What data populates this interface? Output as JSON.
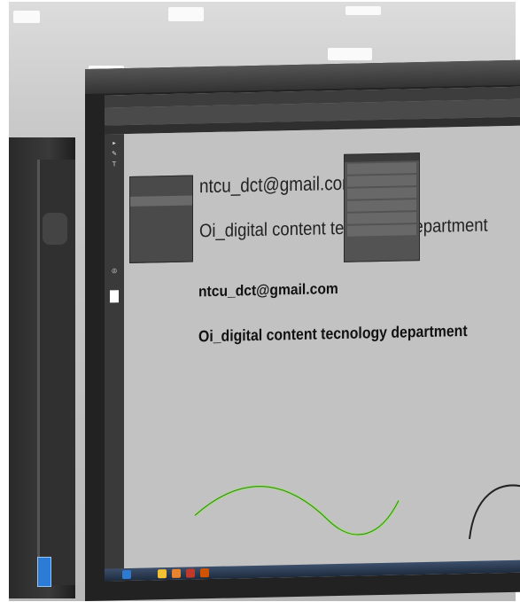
{
  "canvas_text": {
    "email_regular": "ntcu_dct@gmail.com",
    "dept_regular": "Oi_digital content tecnology department",
    "email_bold": "ntcu_dct@gmail.com",
    "dept_bold": "Oi_digital content tecnology department"
  },
  "colors": {
    "screen_bg": "#c2c2c2",
    "panel_bg": "#4a4a4a",
    "path_selected": "#9be26b",
    "text": "#111111"
  },
  "icons": [
    "select-tool-icon",
    "type-tool-icon",
    "pen-tool-icon",
    "zoom-tool-icon"
  ]
}
